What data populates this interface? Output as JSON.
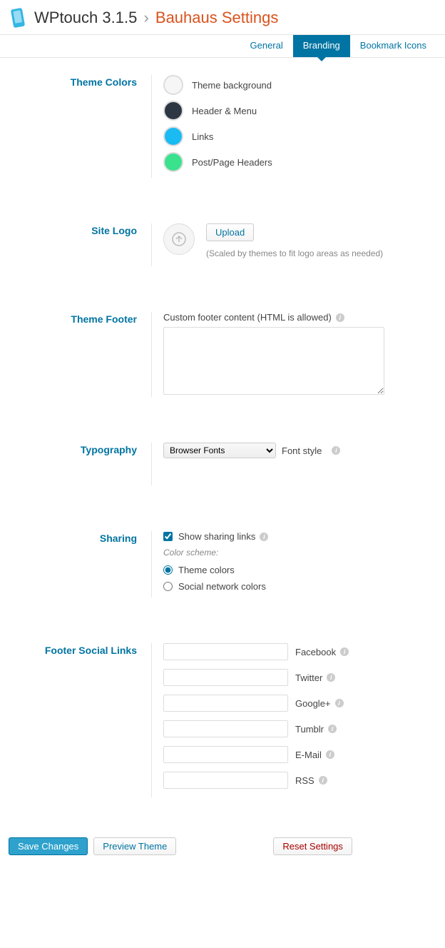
{
  "header": {
    "product": "WPtouch 3.1.5",
    "sep": "›",
    "page": "Bauhaus Settings"
  },
  "tabs": [
    {
      "label": "General",
      "active": false
    },
    {
      "label": "Branding",
      "active": true
    },
    {
      "label": "Bookmark Icons",
      "active": false
    }
  ],
  "sections": {
    "themeColors": {
      "title": "Theme Colors",
      "items": [
        {
          "label": "Theme background",
          "color": "#f6f6f6"
        },
        {
          "label": "Header & Menu",
          "color": "#2d3744"
        },
        {
          "label": "Links",
          "color": "#1abaf2"
        },
        {
          "label": "Post/Page Headers",
          "color": "#3ae28e"
        }
      ]
    },
    "siteLogo": {
      "title": "Site Logo",
      "upload": "Upload",
      "hint": "(Scaled by themes to fit logo areas as needed)"
    },
    "themeFooter": {
      "title": "Theme Footer",
      "label": "Custom footer content (HTML is allowed)",
      "value": ""
    },
    "typography": {
      "title": "Typography",
      "selected": "Browser Fonts",
      "label": "Font style"
    },
    "sharing": {
      "title": "Sharing",
      "showLabel": "Show sharing links",
      "showChecked": true,
      "schemeLabel": "Color scheme:",
      "options": [
        {
          "label": "Theme colors",
          "checked": true
        },
        {
          "label": "Social network colors",
          "checked": false
        }
      ]
    },
    "footerSocial": {
      "title": "Footer Social Links",
      "fields": [
        {
          "label": "Facebook",
          "value": ""
        },
        {
          "label": "Twitter",
          "value": ""
        },
        {
          "label": "Google+",
          "value": ""
        },
        {
          "label": "Tumblr",
          "value": ""
        },
        {
          "label": "E-Mail",
          "value": ""
        },
        {
          "label": "RSS",
          "value": ""
        }
      ]
    }
  },
  "footer": {
    "save": "Save Changes",
    "preview": "Preview Theme",
    "reset": "Reset Settings"
  }
}
